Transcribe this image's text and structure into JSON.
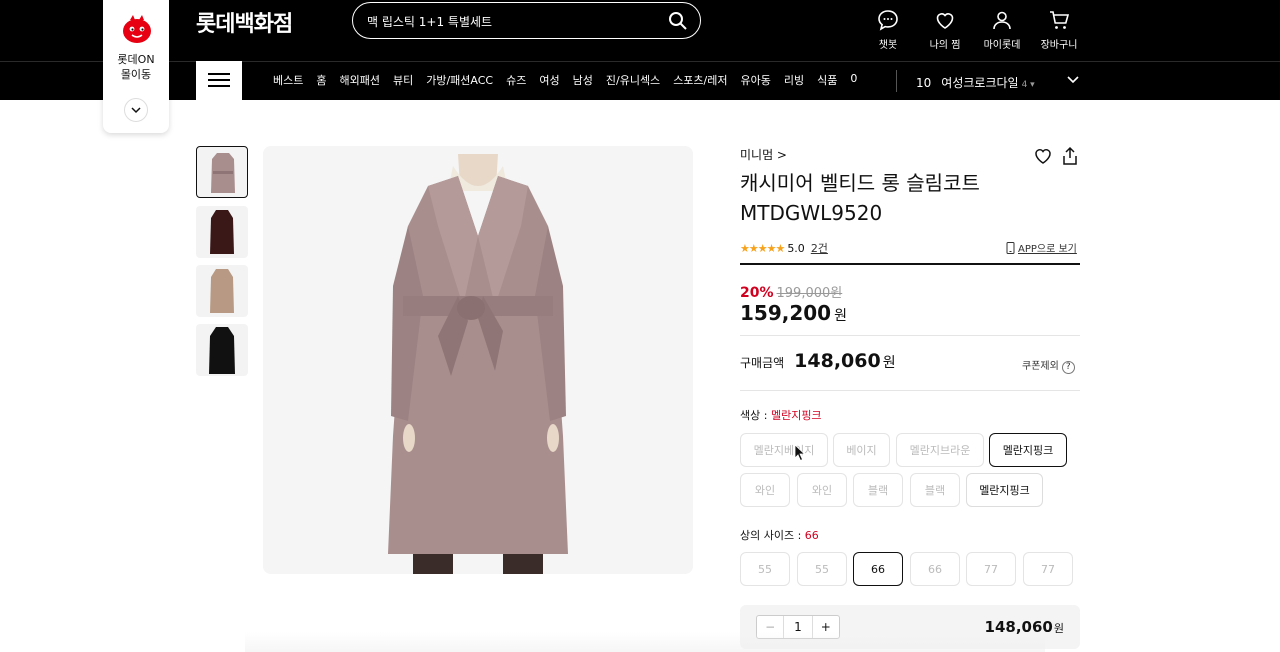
{
  "header": {
    "brand": "롯데백화점",
    "search_value": "맥 립스틱 1+1 특별세트",
    "icons": [
      {
        "name": "chat-icon",
        "label": "챗봇"
      },
      {
        "name": "heart-icon",
        "label": "나의 찜"
      },
      {
        "name": "user-icon",
        "label": "마이롯데"
      },
      {
        "name": "cart-icon",
        "label": "장바구니"
      }
    ]
  },
  "lotteon": {
    "line1": "롯데ON",
    "line2": "몰이동"
  },
  "nav": {
    "categories": [
      "베스트",
      "홈",
      "해외패션",
      "뷰티",
      "가방/패션ACC",
      "슈즈",
      "여성",
      "남성",
      "진/유니섹스",
      "스포츠/레저",
      "유아동",
      "리빙",
      "식품",
      "0"
    ],
    "rank_number": "10",
    "rank_keyword": "여성크로크다일",
    "rank_change": "4 ▾"
  },
  "product": {
    "breadcrumb": "미니멈 >",
    "title_line1": "캐시미어 벨티드 롱 슬림코트",
    "title_line2": "MTDGWL9520",
    "stars": "★★★★★",
    "rating": "5.0",
    "review_count": "2건",
    "app_link": "APP으로 보기",
    "discount": "20%",
    "original_price": "199,000원",
    "sale_price": "159,200",
    "sale_unit": "원",
    "buy_label": "구매금액",
    "buy_amount": "148,060",
    "buy_unit": "원",
    "coupon_label": "쿠폰제외",
    "coupon_q": "?"
  },
  "options": {
    "color_label": "색상 : ",
    "color_selected": "멜란지핑크",
    "colors": [
      {
        "label": "멜란지베이지",
        "state": "disabled"
      },
      {
        "label": "베이지",
        "state": "disabled"
      },
      {
        "label": "멜란지브라운",
        "state": "disabled"
      },
      {
        "label": "멜란지핑크",
        "state": "selected"
      },
      {
        "label": "와인",
        "state": "disabled"
      },
      {
        "label": "와인",
        "state": "disabled"
      },
      {
        "label": "블랙",
        "state": "disabled"
      },
      {
        "label": "블랙",
        "state": "disabled"
      },
      {
        "label": "멜란지핑크",
        "state": "available"
      }
    ],
    "size_label": "상의 사이즈 : ",
    "size_selected": "66",
    "sizes": [
      {
        "label": "55",
        "state": "disabled"
      },
      {
        "label": "55",
        "state": "disabled"
      },
      {
        "label": "66",
        "state": "selected"
      },
      {
        "label": "66",
        "state": "disabled"
      },
      {
        "label": "77",
        "state": "disabled"
      },
      {
        "label": "77",
        "state": "disabled"
      }
    ]
  },
  "quantity": {
    "minus": "−",
    "value": "1",
    "plus": "+",
    "total": "148,060",
    "unit": "원"
  },
  "colors": {
    "accent_red": "#d1001f",
    "star": "#f7a21b",
    "coat": "#a98e8e"
  }
}
